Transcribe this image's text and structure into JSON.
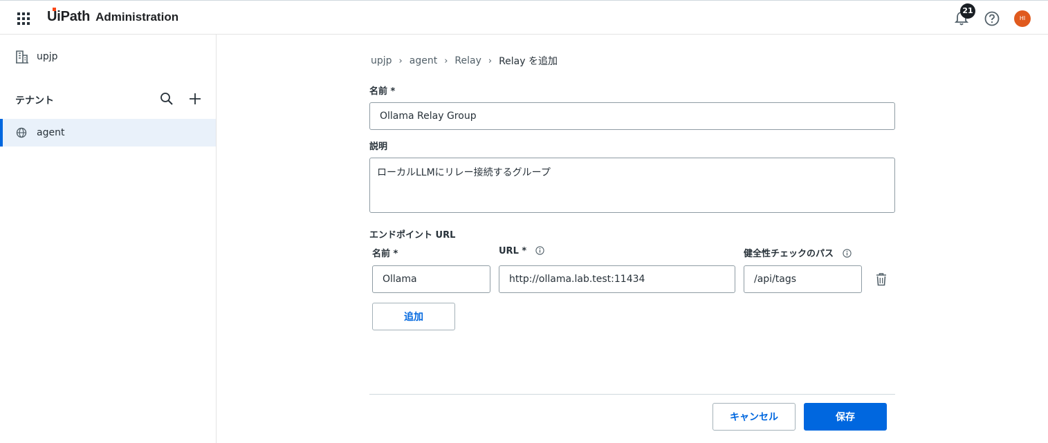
{
  "header": {
    "brand": "UiPath",
    "product": "Administration",
    "notification_count": "21",
    "avatar_initials": "HI",
    "avatar_color": "#e05a1e",
    "brand_accent": "#fa4616"
  },
  "sidebar": {
    "org_name": "upjp",
    "section_title": "テナント",
    "tenants": [
      {
        "label": "agent",
        "selected": true
      }
    ]
  },
  "breadcrumb": {
    "items": [
      "upjp",
      "agent",
      "Relay"
    ],
    "current": "Relay を追加"
  },
  "form": {
    "name_label": "名前 *",
    "name_value": "Ollama Relay Group",
    "description_label": "説明",
    "description_value": "ローカルLLMにリレー接続するグループ",
    "endpoint_section_title": "エンドポイント URL",
    "endpoint_columns": {
      "name": "名前 *",
      "url": "URL *",
      "health_path": "健全性チェックのパス"
    },
    "endpoints": [
      {
        "name": "Ollama",
        "url": "http://ollama.lab.test:11434",
        "health_path": "/api/tags"
      }
    ],
    "add_button": "追加"
  },
  "footer": {
    "cancel_button": "キャンセル",
    "save_button": "保存"
  },
  "colors": {
    "primary": "#0067df",
    "selected_bg": "#e9f1fa"
  },
  "icons": [
    "apps-grid-icon",
    "bell-icon",
    "help-icon",
    "building-icon",
    "search-icon",
    "plus-icon",
    "globe-icon",
    "info-icon",
    "trash-icon"
  ]
}
